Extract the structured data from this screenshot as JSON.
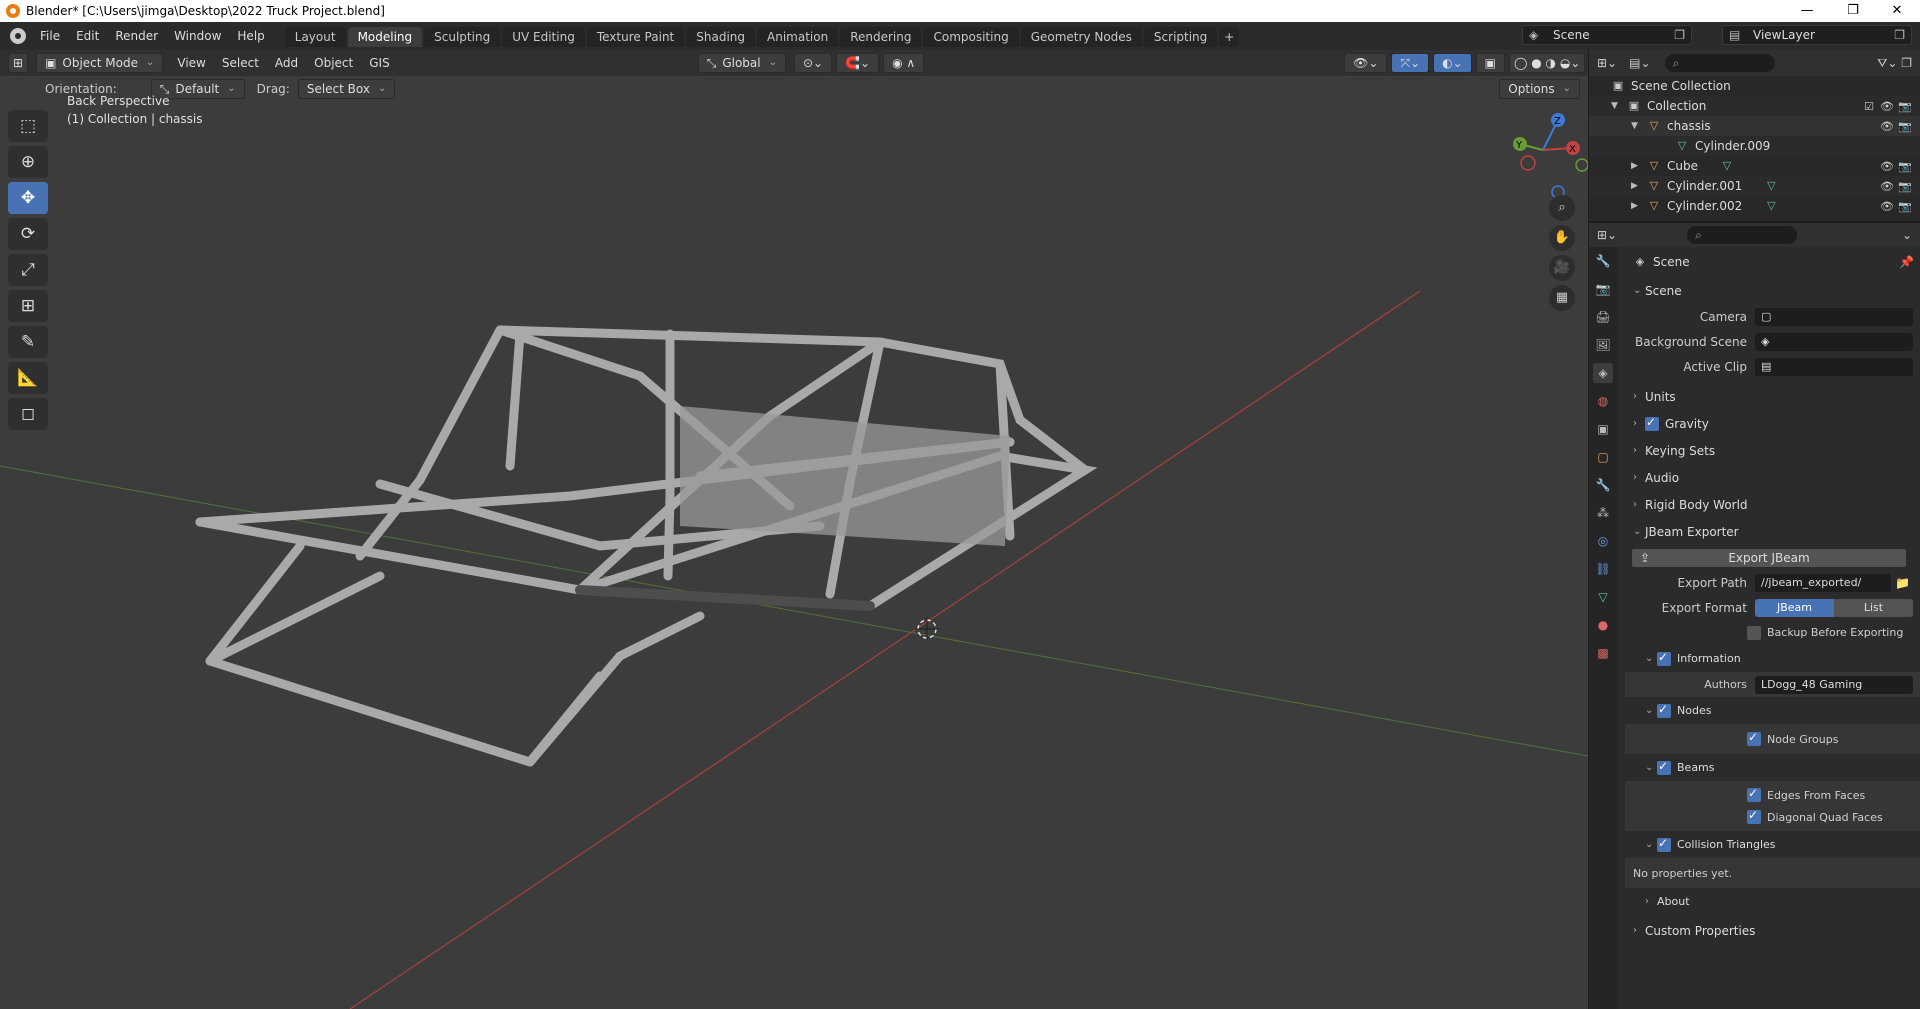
{
  "window": {
    "title": "Blender* [C:\\Users\\jimga\\Desktop\\2022 Truck Project.blend]",
    "minimize": "—",
    "maximize": "❐",
    "close": "✕"
  },
  "menu": [
    "File",
    "Edit",
    "Render",
    "Window",
    "Help"
  ],
  "workspaces": [
    "Layout",
    "Modeling",
    "Sculpting",
    "UV Editing",
    "Texture Paint",
    "Shading",
    "Animation",
    "Rendering",
    "Compositing",
    "Geometry Nodes",
    "Scripting"
  ],
  "active_workspace": "Modeling",
  "scene_name": "Scene",
  "view_layer": "ViewLayer",
  "viewport": {
    "mode": "Object Mode",
    "menus": [
      "View",
      "Select",
      "Add",
      "Object",
      "GIS"
    ],
    "transform": "Global",
    "orientation_label": "Orientation:",
    "orientation_value": "Default",
    "drag_label": "Drag:",
    "drag_value": "Select Box",
    "options": "Options",
    "info_line1": "Back Perspective",
    "info_line2": "(1) Collection | chassis",
    "gizmo": {
      "z": "Z",
      "y": "Y",
      "x": "X"
    }
  },
  "outliner": {
    "rows": [
      {
        "name": "Scene Collection"
      },
      {
        "name": "Collection"
      },
      {
        "name": "chassis"
      },
      {
        "name": "Cylinder.009"
      },
      {
        "name": "Cube"
      },
      {
        "name": "Cylinder.001"
      },
      {
        "name": "Cylinder.002"
      }
    ]
  },
  "properties": {
    "context": "Scene",
    "scene_section": "Scene",
    "camera_label": "Camera",
    "bg_scene_label": "Background Scene",
    "active_clip_label": "Active Clip",
    "sections": [
      "Units",
      "Gravity",
      "Keying Sets",
      "Audio",
      "Rigid Body World"
    ],
    "jbeam": {
      "header": "JBeam Exporter",
      "export_button": "Export JBeam",
      "export_path_label": "Export Path",
      "export_path": "//jbeam_exported/",
      "export_format_label": "Export Format",
      "format_jbeam": "JBeam",
      "format_list": "List",
      "backup_label": "Backup Before Exporting",
      "information": "Information",
      "authors_label": "Authors",
      "authors": "LDogg_48 Gaming",
      "nodes": "Nodes",
      "node_groups": "Node Groups",
      "beams": "Beams",
      "edges_from_faces": "Edges From Faces",
      "diagonal_quad_faces": "Diagonal Quad Faces",
      "collision_triangles": "Collision Triangles",
      "no_props": "No properties yet.",
      "about": "About"
    },
    "custom_properties": "Custom Properties"
  },
  "colors": {
    "accent": "#4772b3",
    "viewport_bg": "#3c3c3c",
    "x_axis": "#c24141",
    "y_axis": "#6a9a35",
    "z_axis": "#3d7bd9"
  }
}
